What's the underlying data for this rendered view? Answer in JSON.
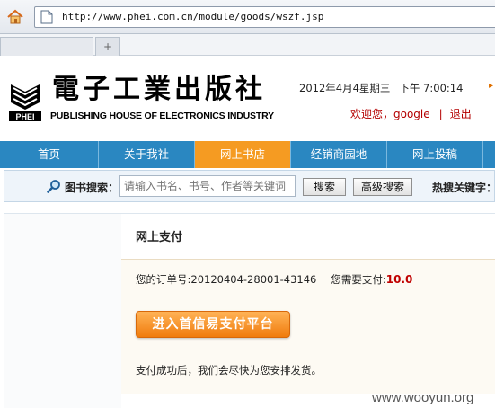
{
  "browser": {
    "url": "http://www.phei.com.cn/module/goods/wszf.jsp",
    "new_tab_symbol": "+"
  },
  "header": {
    "logo_cn": "電子工業出版社",
    "logo_en": "PUBLISHING HOUSE OF ELECTRONICS INDUSTRY",
    "logo_badge": "PHEI",
    "date": "2012年4月4星期三",
    "time": "下午 7:00:14",
    "welcome": "欢迎您，google",
    "separator": "|",
    "logout": "退出"
  },
  "nav": {
    "items": [
      {
        "label": "首页"
      },
      {
        "label": "关于我社"
      },
      {
        "label": "网上书店"
      },
      {
        "label": "经销商园地"
      },
      {
        "label": "网上投稿"
      }
    ],
    "active_index": 2,
    "colors": {
      "bar": "#2a87c1",
      "active": "#f59b22"
    }
  },
  "search": {
    "label": "图书搜索：",
    "placeholder": "请输入书名、书号、作者等关键词",
    "search_button": "搜索",
    "advanced_button": "高级搜索",
    "hot_label": "热搜关键字："
  },
  "payment": {
    "title": "网上支付",
    "order_label": "您的订单号:",
    "order_number": "20120404-28001-43146",
    "amount_label": "您需要支付:",
    "amount": "10.0",
    "pay_button": "进入首信易支付平台",
    "notice": "支付成功后，我们会尽快为您安排发货。"
  },
  "watermark": "www.wooyun.org"
}
